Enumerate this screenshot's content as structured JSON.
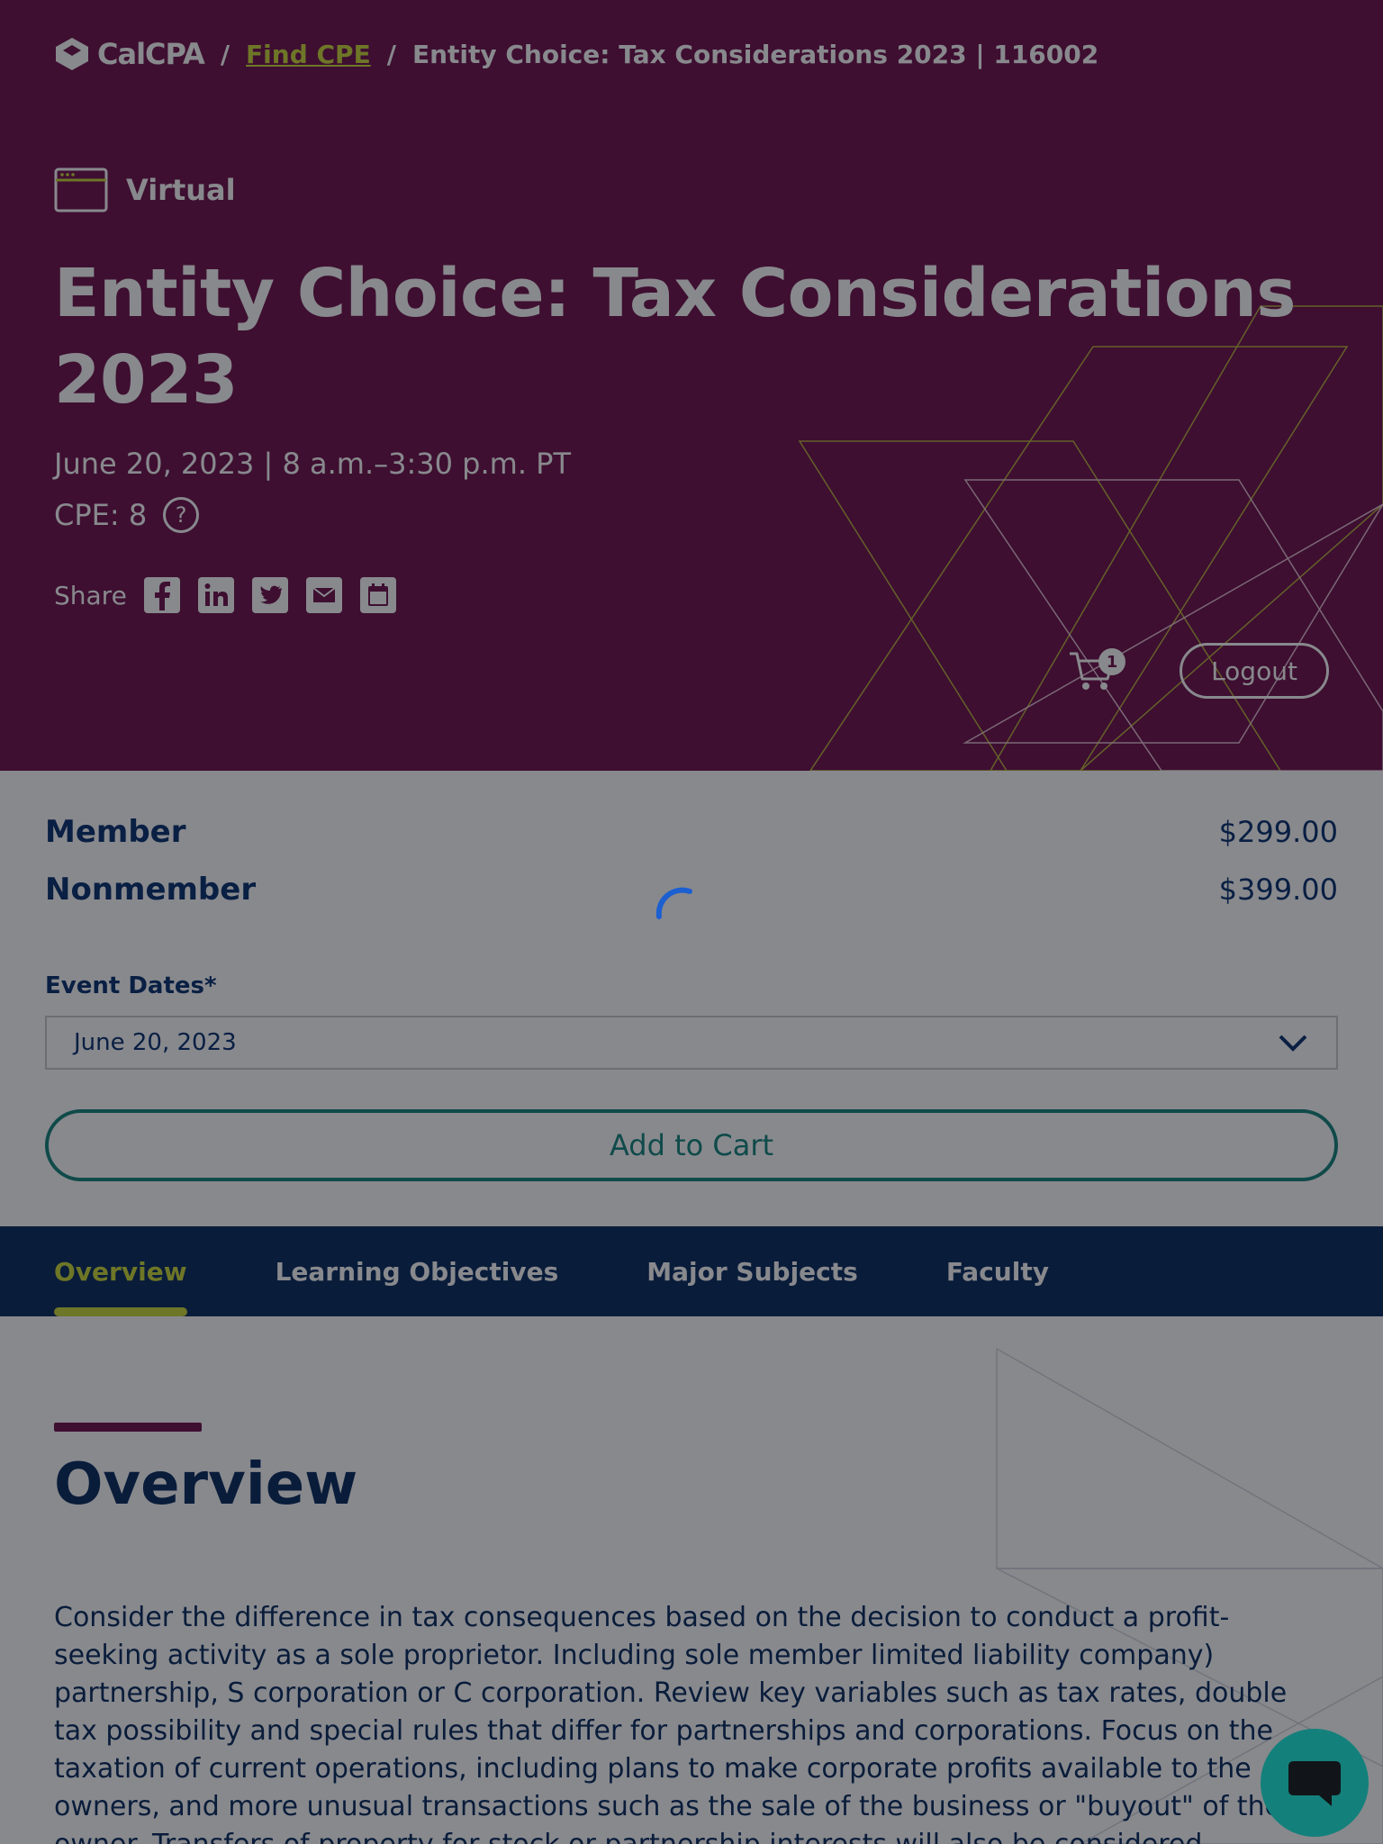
{
  "breadcrumb": {
    "logo": "CalCPA",
    "sep": "/",
    "link": "Find CPE",
    "current": "Entity Choice: Tax Considerations 2023 | 116002"
  },
  "hero": {
    "format": "Virtual",
    "title": "Entity Choice: Tax Considerations 2023",
    "dateline": "June 20, 2023 | 8 a.m.–3:30 p.m. PT",
    "cpe": "CPE: 8",
    "help_glyph": "?",
    "share_label": "Share",
    "share_icons": [
      "facebook-icon",
      "linkedin-icon",
      "twitter-icon",
      "email-icon",
      "calendar-icon"
    ],
    "cart_count": "1",
    "logout": "Logout"
  },
  "pricing": {
    "member_label": "Member",
    "member_price": "$299.00",
    "nonmember_label": "Nonmember",
    "nonmember_price": "$399.00",
    "event_dates_label": "Event Dates*",
    "event_date_selected": "June 20, 2023",
    "add_to_cart": "Add to Cart"
  },
  "tabs": [
    "Overview",
    "Learning Objectives",
    "Major Subjects",
    "Faculty"
  ],
  "content": {
    "heading": "Overview",
    "body": "Consider the difference in tax consequences based on the decision to conduct a profit-seeking activity as a sole proprietor. Including sole member limited liability company) partnership, S corporation or C corporation. Review key variables such as tax rates, double tax possibility and special rules that differ for partnerships and corporations. Focus on the taxation of current operations, including plans to make corporate profits available to the owners, and more unusual transactions such as the sale of the business or \"buyout\" of the owner. Transfers of property for stock or partnership interests will also be considered."
  },
  "colors": {
    "hero_bg": "#6b0a47",
    "accent_yellow": "#cbd833",
    "navy": "#002459",
    "teal": "#0f8078",
    "overlay": "rgba(18,20,28,0.5)"
  }
}
